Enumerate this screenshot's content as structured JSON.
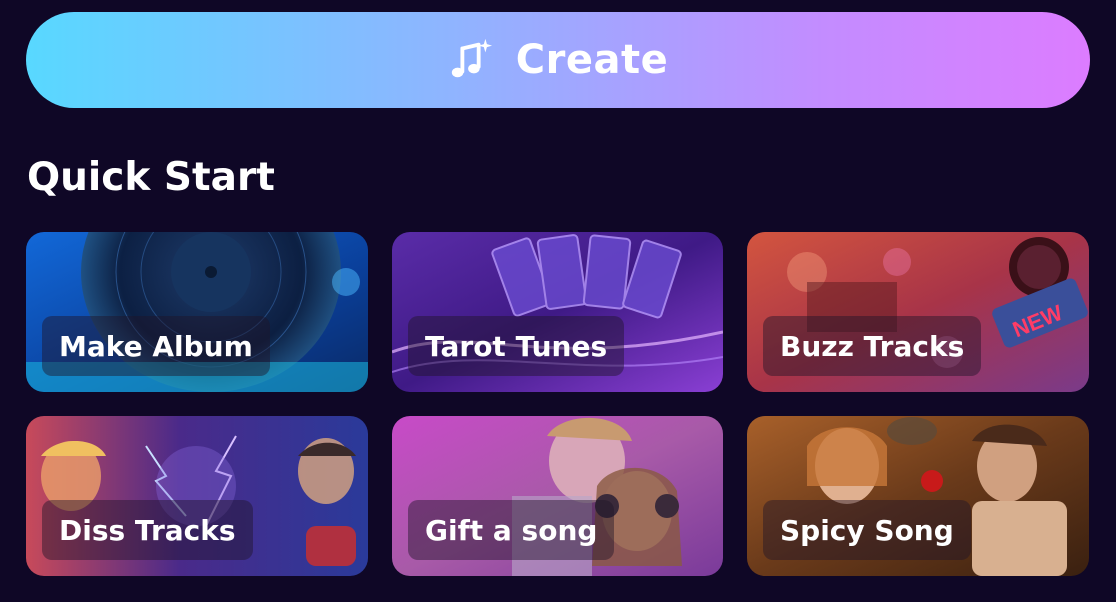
{
  "create_button": {
    "label": "Create",
    "icon": "music-sparkle-icon"
  },
  "quick_start": {
    "title": "Quick Start",
    "cards": [
      {
        "label": "Make Album",
        "image": "vinyl-record-image"
      },
      {
        "label": "Tarot Tunes",
        "image": "tarot-cards-image"
      },
      {
        "label": "Buzz Tracks",
        "image": "news-microphone-image"
      },
      {
        "label": "Diss Tracks",
        "image": "rap-battle-image"
      },
      {
        "label": "Gift a song",
        "image": "couple-headphones-image"
      },
      {
        "label": "Spicy Song",
        "image": "classical-painting-image"
      }
    ]
  },
  "colors": {
    "background": "#0f0726",
    "create_gradient_start": "#58d8ff",
    "create_gradient_end": "#dc7cff"
  }
}
